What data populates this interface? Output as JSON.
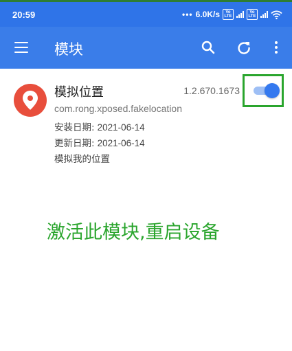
{
  "status_bar": {
    "time": "20:59",
    "speed": "6.0K/s",
    "volte": "Vo LTE",
    "dots": "•••"
  },
  "app_bar": {
    "title": "模块",
    "menu_icon": "menu-icon",
    "search_icon": "search-icon",
    "refresh_icon": "refresh-icon",
    "more_icon": "more-vert-icon"
  },
  "module": {
    "name": "模拟位置",
    "version": "1.2.670.1673",
    "package": "com.rong.xposed.fakelocation",
    "install_label": "安装日期:",
    "install_date": "2021-06-14",
    "update_label": "更新日期:",
    "update_date": "2021-06-14",
    "description": "模拟我的位置",
    "enabled": true,
    "icon": "location-pin-icon"
  },
  "annotation": {
    "instruction": "激活此模块,重启设备"
  },
  "colors": {
    "status_bar": "#2f74e8",
    "app_bar": "#3a7de9",
    "toggle_on": "#3479ef",
    "app_icon": "#e84e3c",
    "highlight": "#2aa52d"
  }
}
